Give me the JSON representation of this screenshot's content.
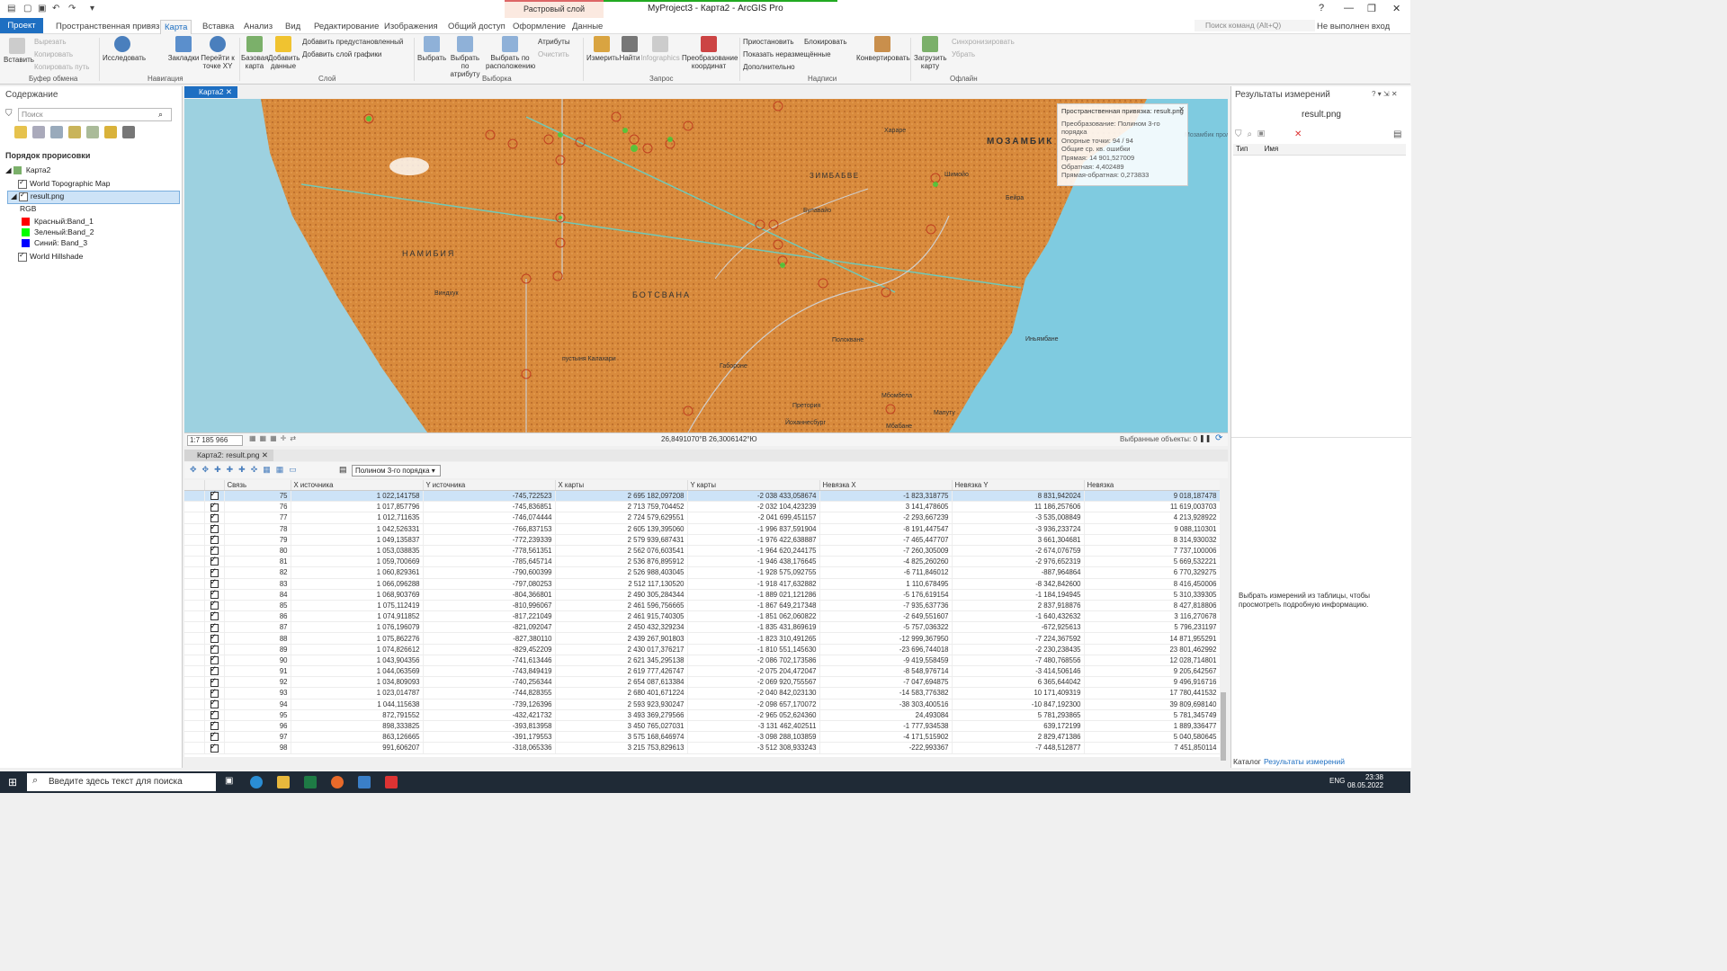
{
  "window": {
    "title": "MyProject3 - Карта2 - ArcGIS Pro",
    "context_tab_group": "Растровый слой",
    "help": "?",
    "buttons": [
      "—",
      "❐",
      "✕"
    ]
  },
  "tabs": [
    "Проект",
    "Пространственная привязка",
    "Карта",
    "Вставка",
    "Анализ",
    "Вид",
    "Редактирование",
    "Изображения",
    "Общий доступ",
    "Оформление",
    "Данные"
  ],
  "active_tab": "Карта",
  "command_search_placeholder": "Поиск команд (Alt+Q)",
  "sign_in": "Не выполнен вход",
  "ribbon": {
    "clipboard": {
      "paste": "Вставить",
      "cut": "Вырезать",
      "copy": "Копировать",
      "copy_path": "Копировать путь",
      "group": "Буфер обмена"
    },
    "navigation": {
      "explore": "Исследовать",
      "bookmarks": "Закладки",
      "goto_xy": "Перейти к точке XY",
      "group": "Навигация"
    },
    "layer": {
      "basemap": "Базовая карта",
      "add_data": "Добавить данные",
      "add_preset": "Добавить предустановленный",
      "add_graphics": "Добавить слой графики",
      "group": "Слой"
    },
    "selection": {
      "select": "Выбрать",
      "by_attr": "Выбрать по атрибуту",
      "by_location": "Выбрать по расположению",
      "attributes": "Атрибуты",
      "clear": "Очистить",
      "group": "Выборка"
    },
    "inquiry": {
      "measure": "Измерить",
      "locate": "Найти",
      "infographics": "Infographics",
      "convert_coords": "Преобразование координат",
      "group": "Запрос"
    },
    "labeling": {
      "pause": "Приостановить",
      "lock": "Блокировать",
      "show_unplaced": "Показать неразмещённые",
      "more": "Дополнительно",
      "group": "Надписи"
    },
    "convert": "Конвертировать",
    "offline": {
      "download": "Загрузить карту",
      "sync": "Синхронизировать",
      "remove": "Убрать",
      "group": "Офлайн"
    }
  },
  "contents": {
    "title": "Содержание",
    "search_placeholder": "Поиск",
    "drawing_order": "Порядок прорисовки",
    "map_name": "Карта2",
    "layers": [
      {
        "name": "World Topographic Map",
        "checked": true
      },
      {
        "name": "result.png",
        "checked": true
      },
      {
        "name": "World Hillshade",
        "checked": true
      }
    ],
    "rgb_label": "RGB",
    "bands": [
      {
        "name": "Красный:Band_1",
        "color": "#ff0000"
      },
      {
        "name": "Зеленый:Band_2",
        "color": "#00ff00"
      },
      {
        "name": "Синий: Band_3",
        "color": "#0000ff"
      }
    ]
  },
  "map": {
    "tab": "Карта2",
    "labels": [
      "МОЗАМБИК",
      "НАМИБИЯ",
      "БОТСВАНА",
      "ЗИМБАБВЕ",
      "пустыня Калахари",
      "Хараре",
      "Шимойо",
      "Бейра",
      "Булавайо",
      "Виндхук",
      "Полокване",
      "Габороне",
      "Претория",
      "Йоханнесбург",
      "Мапуту",
      "Мбабане",
      "Мбомбела",
      "Иньямбане",
      "Мозамбик проли"
    ],
    "tooltip": {
      "title": "Пространственная привязка: result.png",
      "lines": [
        "Преобразование: Полином 3-го порядка",
        "Опорные точки: 94 / 94",
        "Общие ср. кв. ошибки",
        "Прямая: 14 901,527009",
        "Обратная: 4,402489",
        "Прямая-обратная: 0,273833"
      ]
    }
  },
  "status": {
    "scale": "1:7 185 966",
    "coords": "26,8491070°В 26,3006142°Ю",
    "selected": "Выбранные объекты: 0"
  },
  "table": {
    "tab": "Карта2: result.png",
    "transform": "Полином 3-го порядка",
    "columns": [
      "Связь",
      "X источника",
      "Y источника",
      "X карты",
      "Y карты",
      "Невязка X",
      "Невязка Y",
      "Невязка"
    ],
    "rows": [
      [
        "75",
        "1 022,141758",
        "-745,722523",
        "2 695 182,097208",
        "-2 038 433,058674",
        "-1 823,318775",
        "8 831,942024",
        "9 018,187478"
      ],
      [
        "76",
        "1 017,857796",
        "-745,836851",
        "2 713 759,704452",
        "-2 032 104,423239",
        "3 141,478605",
        "11 186,257606",
        "11 619,003703"
      ],
      [
        "77",
        "1 012,711635",
        "-746,074444",
        "2 724 579,629551",
        "-2 041 699,451157",
        "-2 293,667239",
        "-3 535,008849",
        "4 213,928922"
      ],
      [
        "78",
        "1 042,526331",
        "-766,837153",
        "2 605 139,395060",
        "-1 996 837,591904",
        "-8 191,447547",
        "-3 936,233724",
        "9 088,110301"
      ],
      [
        "79",
        "1 049,135837",
        "-772,239339",
        "2 579 939,687431",
        "-1 976 422,638887",
        "-7 465,447707",
        "3 661,304681",
        "8 314,930032"
      ],
      [
        "80",
        "1 053,038835",
        "-778,561351",
        "2 562 076,603541",
        "-1 964 620,244175",
        "-7 260,305009",
        "-2 674,076759",
        "7 737,100006"
      ],
      [
        "81",
        "1 059,700669",
        "-785,645714",
        "2 536 876,895912",
        "-1 946 438,176645",
        "-4 825,260260",
        "-2 976,652319",
        "5 669,532221"
      ],
      [
        "82",
        "1 060,829361",
        "-790,600399",
        "2 526 988,403045",
        "-1 928 575,092755",
        "-6 711,846012",
        "-887,964864",
        "6 770,329275"
      ],
      [
        "83",
        "1 066,096288",
        "-797,080253",
        "2 512 117,130520",
        "-1 918 417,632882",
        "1 110,678495",
        "-8 342,842600",
        "8 416,450006"
      ],
      [
        "84",
        "1 068,903769",
        "-804,366801",
        "2 490 305,284344",
        "-1 889 021,121286",
        "-5 176,619154",
        "-1 184,194945",
        "5 310,339305"
      ],
      [
        "85",
        "1 075,112419",
        "-810,996067",
        "2 461 596,756665",
        "-1 867 649,217348",
        "-7 935,637736",
        "2 837,918876",
        "8 427,818806"
      ],
      [
        "86",
        "1 074,911852",
        "-817,221049",
        "2 461 915,740305",
        "-1 851 062,060822",
        "-2 649,551607",
        "-1 640,432632",
        "3 116,270678"
      ],
      [
        "87",
        "1 076,196079",
        "-821,092047",
        "2 450 432,329234",
        "-1 835 431,869619",
        "-5 757,036322",
        "-672,925613",
        "5 796,231197"
      ],
      [
        "88",
        "1 075,862276",
        "-827,380110",
        "2 439 267,901803",
        "-1 823 310,491265",
        "-12 999,367950",
        "-7 224,367592",
        "14 871,955291"
      ],
      [
        "89",
        "1 074,826612",
        "-829,452209",
        "2 430 017,376217",
        "-1 810 551,145630",
        "-23 696,744018",
        "-2 230,238435",
        "23 801,462992"
      ],
      [
        "90",
        "1 043,904356",
        "-741,613446",
        "2 621 345,295138",
        "-2 086 702,173586",
        "-9 419,558459",
        "-7 480,768556",
        "12 028,714801"
      ],
      [
        "91",
        "1 044,063569",
        "-743,849419",
        "2 619 777,426747",
        "-2 075 204,472047",
        "-8 548,976714",
        "-3 414,506146",
        "9 205,642567"
      ],
      [
        "92",
        "1 034,809093",
        "-740,256344",
        "2 654 087,613384",
        "-2 069 920,755567",
        "-7 047,694875",
        "6 365,644042",
        "9 496,916716"
      ],
      [
        "93",
        "1 023,014787",
        "-744,828355",
        "2 680 401,671224",
        "-2 040 842,023130",
        "-14 583,776382",
        "10 171,409319",
        "17 780,441532"
      ],
      [
        "94",
        "1 044,115638",
        "-739,126396",
        "2 593 923,930247",
        "-2 098 657,170072",
        "-38 303,400516",
        "-10 847,192300",
        "39 809,698140"
      ],
      [
        "95",
        "872,791552",
        "-432,421732",
        "3 493 369,279566",
        "-2 965 052,624360",
        "24,493084",
        "5 781,293865",
        "5 781,345749"
      ],
      [
        "96",
        "898,333825",
        "-393,813958",
        "3 450 765,027031",
        "-3 131 462,402511",
        "-1 777,934538",
        "639,172199",
        "1 889,336477"
      ],
      [
        "97",
        "863,126665",
        "-391,179553",
        "3 575 168,646974",
        "-3 098 288,103859",
        "-4 171,515902",
        "2 829,471386",
        "5 040,580645"
      ],
      [
        "98",
        "991,606207",
        "-318,065336",
        "3 215 753,829613",
        "-3 512 308,933243",
        "-222,993367",
        "-7 448,512877",
        "7 451,850114"
      ]
    ]
  },
  "measure": {
    "title": "Результаты измерений",
    "layer": "result.png",
    "columns": [
      "Тип",
      "Имя"
    ],
    "hint": "Выбрать измерений из таблицы, чтобы просмотреть подробную информацию.",
    "tabs": [
      "Каталог",
      "Результаты измерений"
    ]
  },
  "taskbar": {
    "search": "Введите здесь текст для поиска",
    "lang": "ENG",
    "time": "23:38",
    "date": "08.05.2022"
  }
}
